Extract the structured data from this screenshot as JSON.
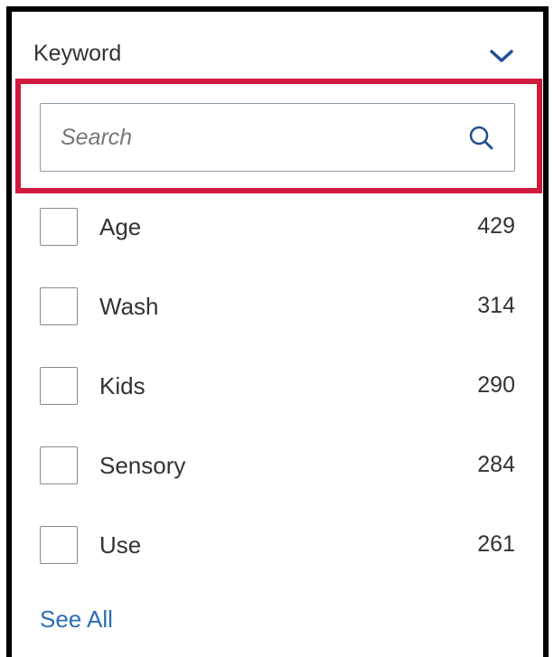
{
  "facet": {
    "title": "Keyword",
    "toggle_icon": "chevron-down-icon",
    "search": {
      "placeholder": "Search",
      "value": "",
      "icon": "search-icon"
    },
    "items": [
      {
        "label": "Age",
        "count": "429",
        "checked": false
      },
      {
        "label": "Wash",
        "count": "314",
        "checked": false
      },
      {
        "label": "Kids",
        "count": "290",
        "checked": false
      },
      {
        "label": "Sensory",
        "count": "284",
        "checked": false
      },
      {
        "label": "Use",
        "count": "261",
        "checked": false
      }
    ],
    "see_all_label": "See All"
  },
  "colors": {
    "accent": "#1f4f8f",
    "link": "#2a6db5",
    "highlight": "#d1193e",
    "frame": "#000000"
  }
}
